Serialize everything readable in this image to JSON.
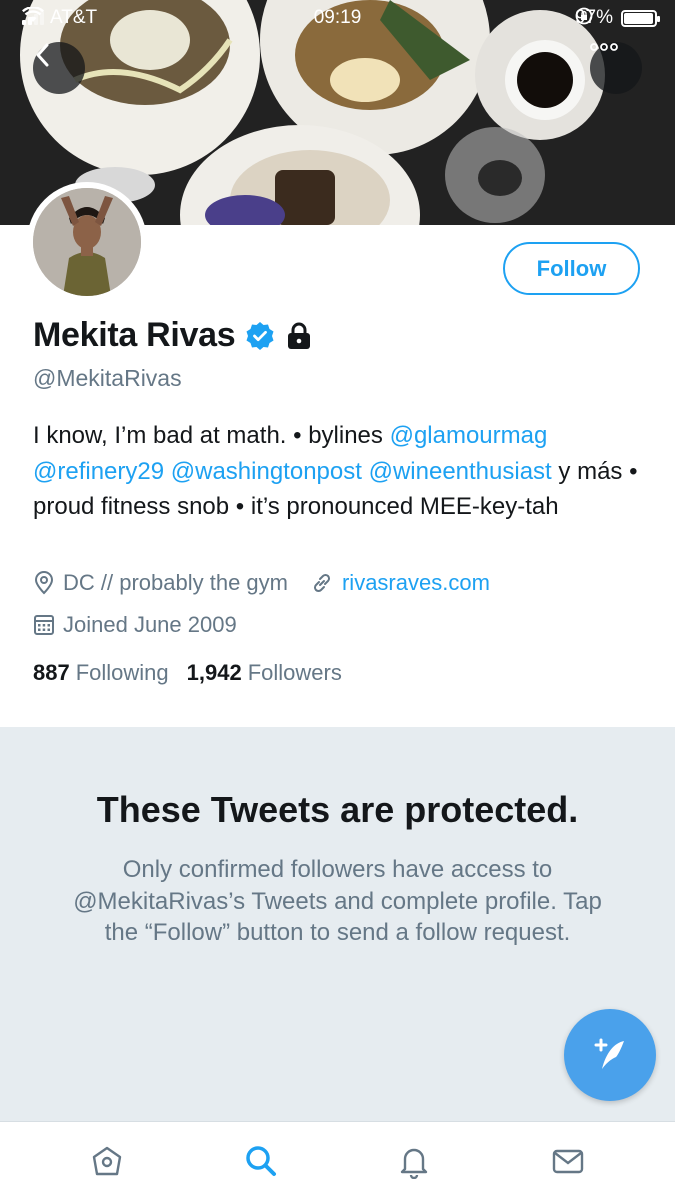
{
  "status_bar": {
    "carrier": "AT&T",
    "time": "09:19",
    "battery_percent": "97%",
    "battery_level": 0.97
  },
  "profile": {
    "display_name": "Mekita Rivas",
    "handle": "@MekitaRivas",
    "verified": true,
    "protected": true,
    "follow_label": "Follow",
    "bio": {
      "part1": "I know, I’m bad at math. • bylines ",
      "mention1": "@glamourmag",
      "sep1": " ",
      "mention2": "@refinery29",
      "sep2": " ",
      "mention3": "@washingtonpost",
      "sep3": " ",
      "mention4": "@wineenthusiast",
      "part2": " y más • proud fitness snob • it’s pronounced MEE-key-tah"
    },
    "location": "DC // probably the gym",
    "website": "rivasraves.com",
    "joined": "Joined June 2009",
    "following_count": "887",
    "following_label": "Following",
    "followers_count": "1,942",
    "followers_label": "Followers"
  },
  "protected_notice": {
    "title": "These Tweets are protected.",
    "message": "Only confirmed followers have access to @MekitaRivas’s Tweets and complete profile. Tap the “Follow” button to send a follow request."
  },
  "tabbar": {
    "items": [
      "home-icon",
      "search-icon",
      "notifications-icon",
      "messages-icon"
    ],
    "active": "search-icon"
  },
  "colors": {
    "accent": "#1da1f2",
    "secondary_text": "#657786",
    "protected_bg": "#e6ecf0",
    "fab": "#4aa1eb"
  }
}
